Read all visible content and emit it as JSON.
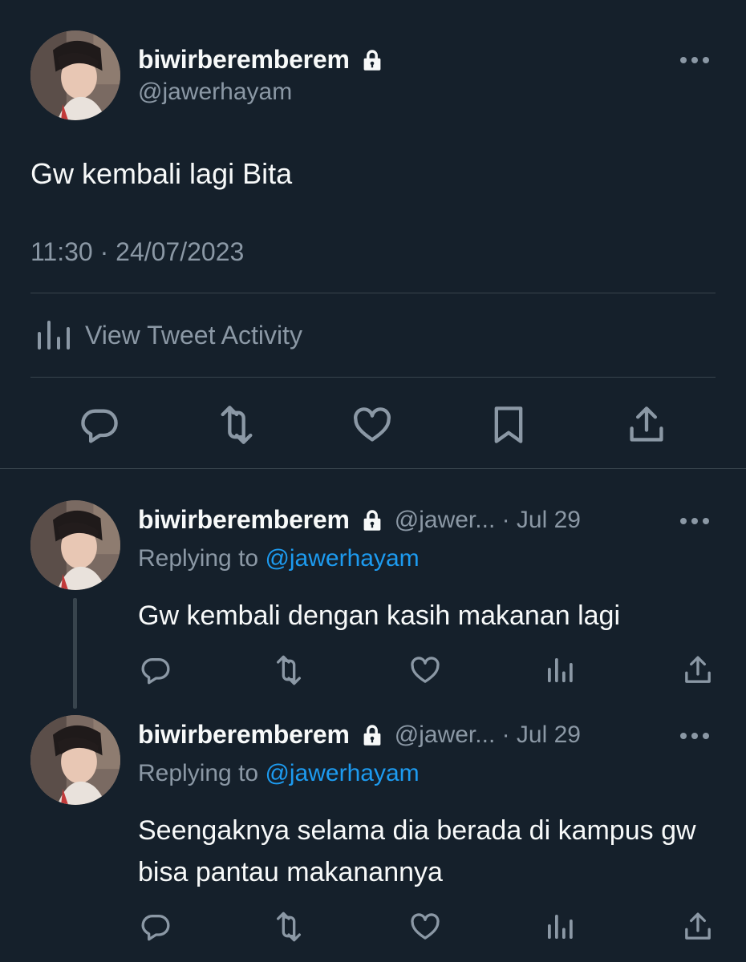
{
  "main_tweet": {
    "display_name": "biwirberemberem",
    "handle": "@jawerhayam",
    "text": "Gw kembali lagi Bita",
    "timestamp": "11:30 · 24/07/2023",
    "activity_label": "View Tweet Activity",
    "actions": [
      "reply-icon",
      "retweet-icon",
      "like-icon",
      "bookmark-icon",
      "share-icon"
    ]
  },
  "replies": [
    {
      "display_name": "biwirberemberem",
      "handle_date": "@jawer... · Jul 29",
      "replying_prefix": "Replying to ",
      "replying_to": "@jawerhayam",
      "text": "Gw kembali dengan kasih makanan lagi"
    },
    {
      "display_name": "biwirberemberem",
      "handle_date": "@jawer... · Jul 29",
      "replying_prefix": "Replying to ",
      "replying_to": "@jawerhayam",
      "text": "Seengaknya selama dia berada di kampus gw bisa pantau makanannya"
    }
  ],
  "colors": {
    "background": "#15202b",
    "primary_text": "#f7f9f9",
    "secondary_text": "#8b98a5",
    "accent": "#1d9bf0",
    "divider": "#38444d"
  }
}
